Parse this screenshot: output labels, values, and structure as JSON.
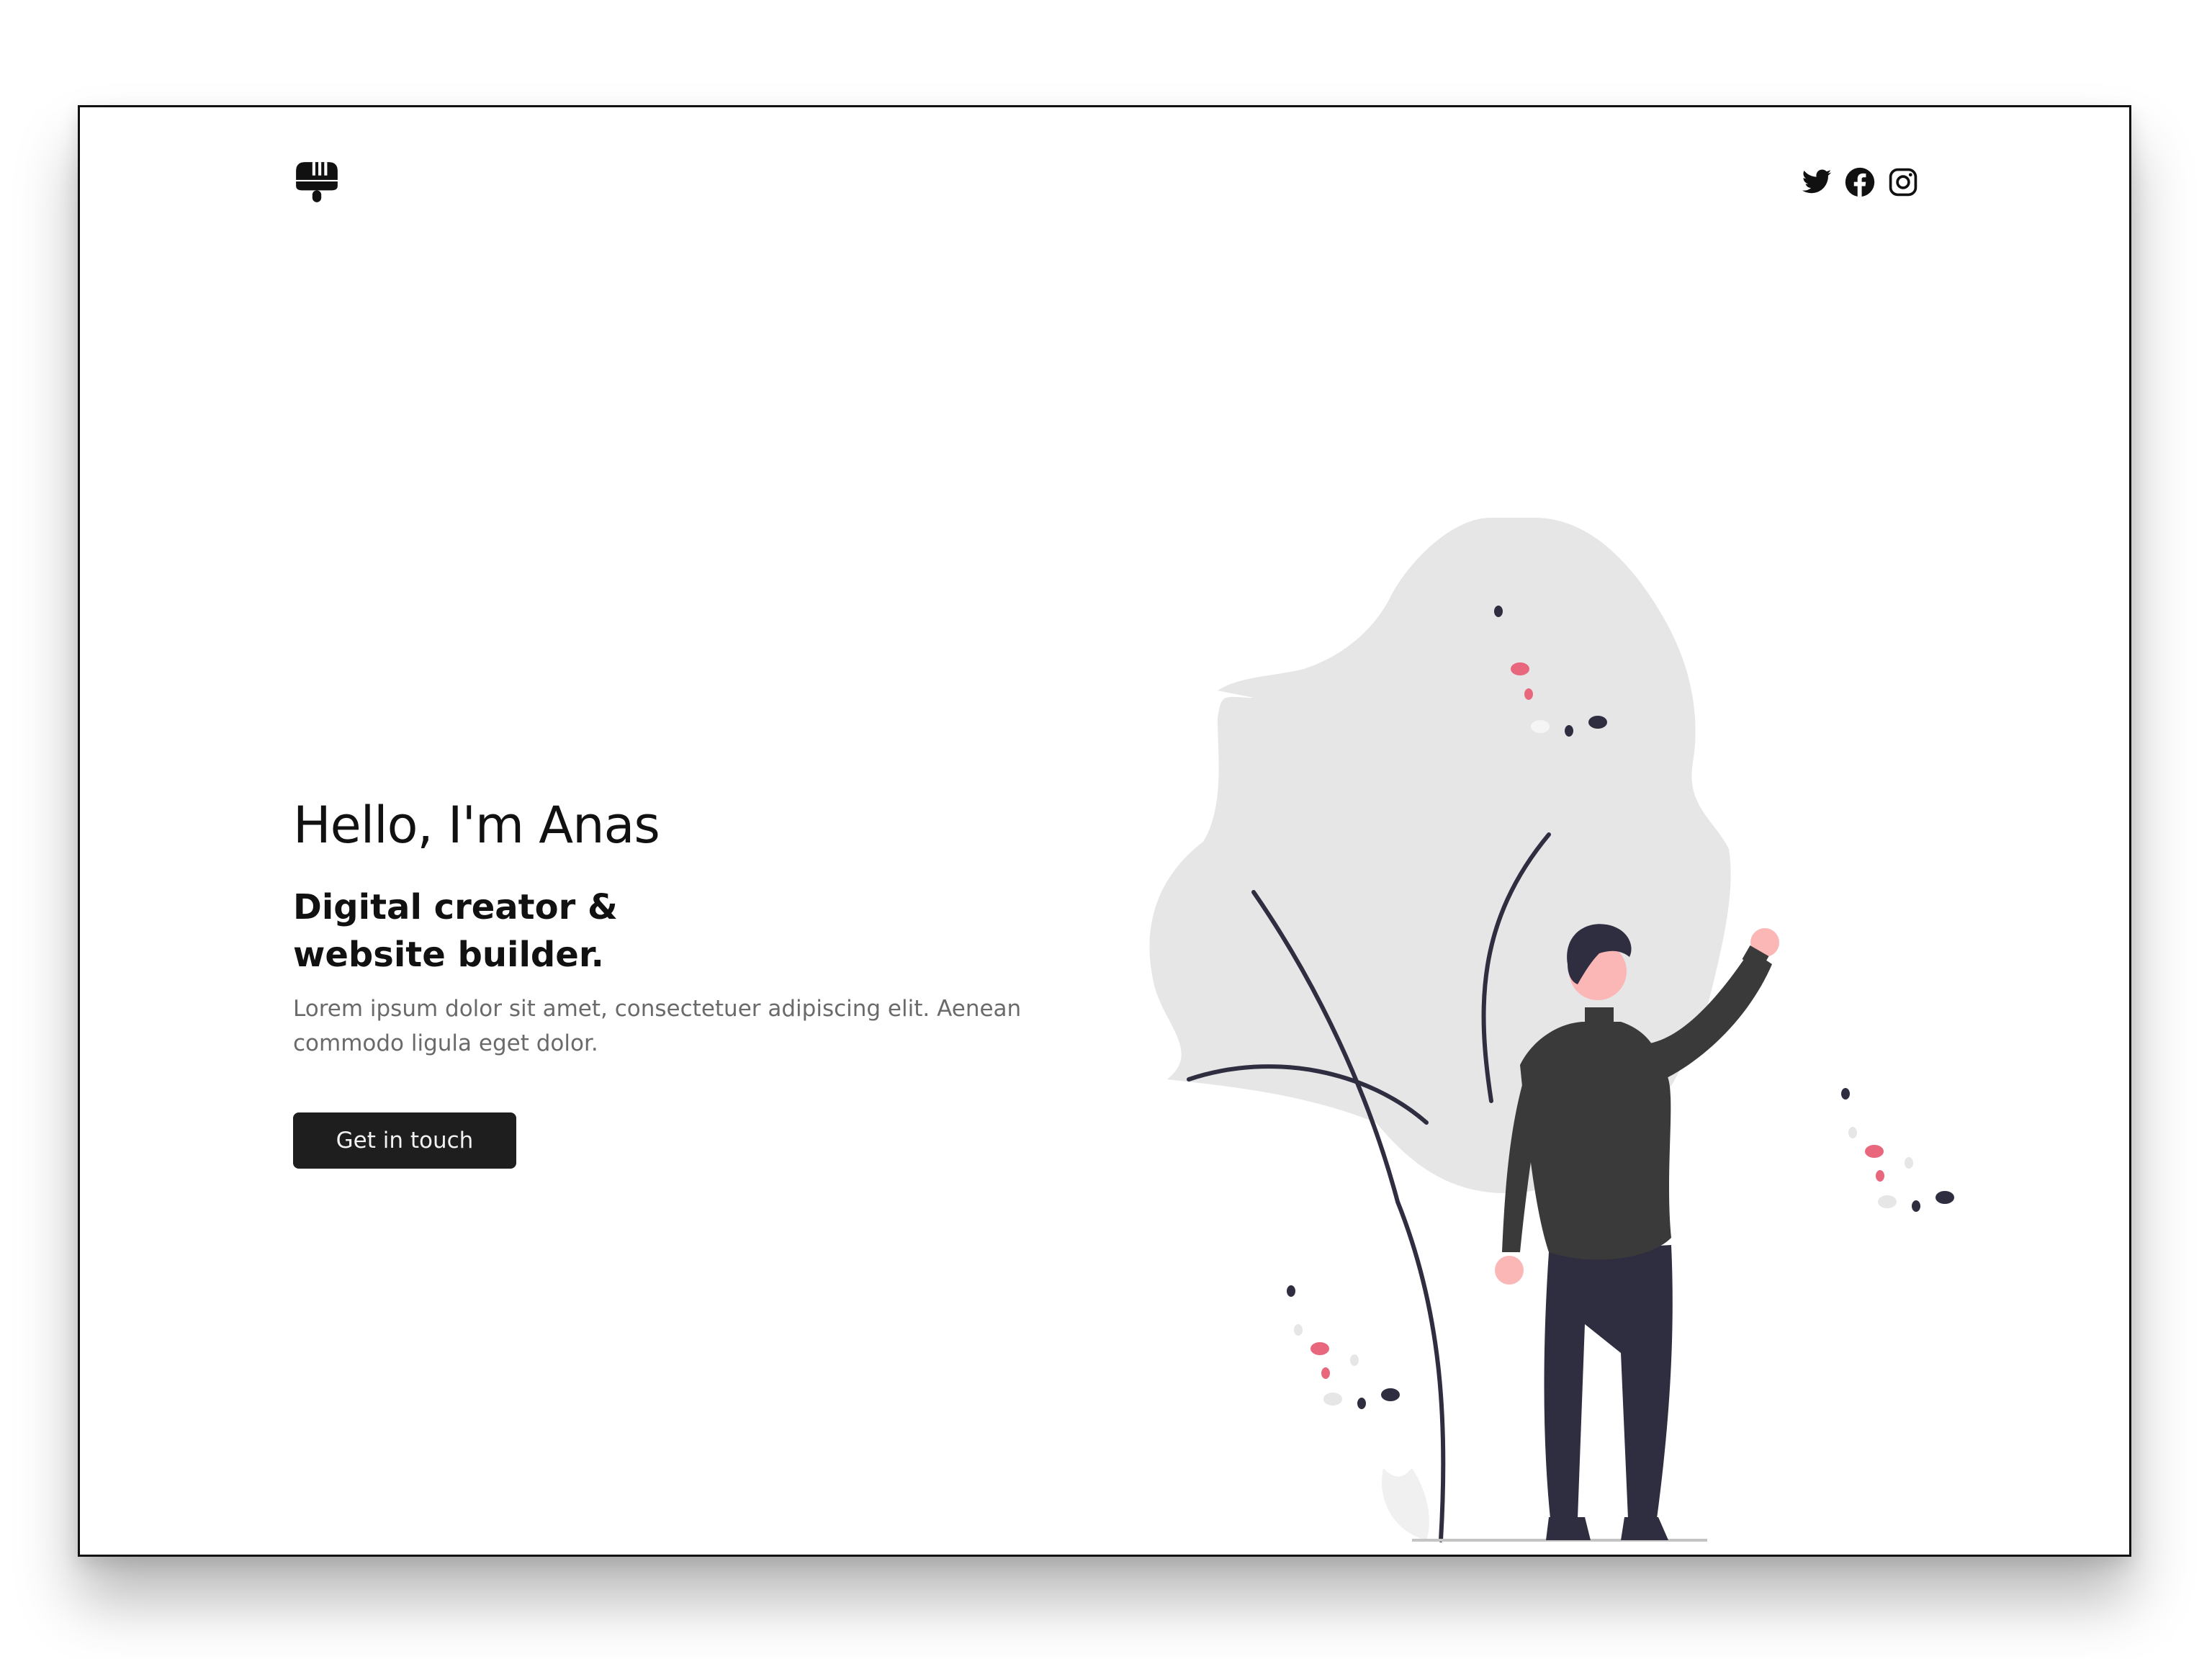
{
  "header": {
    "logo_icon": "paintbrush-icon",
    "social": [
      {
        "name": "twitter",
        "icon": "twitter-icon"
      },
      {
        "name": "facebook",
        "icon": "facebook-icon"
      },
      {
        "name": "instagram",
        "icon": "instagram-icon"
      }
    ]
  },
  "hero": {
    "greeting": "Hello, I'm Anas",
    "tagline": "Digital creator & website builder.",
    "description": "Lorem ipsum dolor sit amet, consectetuer adipiscing elit. Aenean commodo ligula eget dolor.",
    "cta_label": "Get in touch"
  },
  "colors": {
    "text": "#111111",
    "muted": "#6a6a6a",
    "button": "#1e1e1e",
    "blob": "#e6e6e6",
    "accent_pink": "#e8677d",
    "navy": "#2f2e41",
    "skin": "#fbb6b6"
  }
}
